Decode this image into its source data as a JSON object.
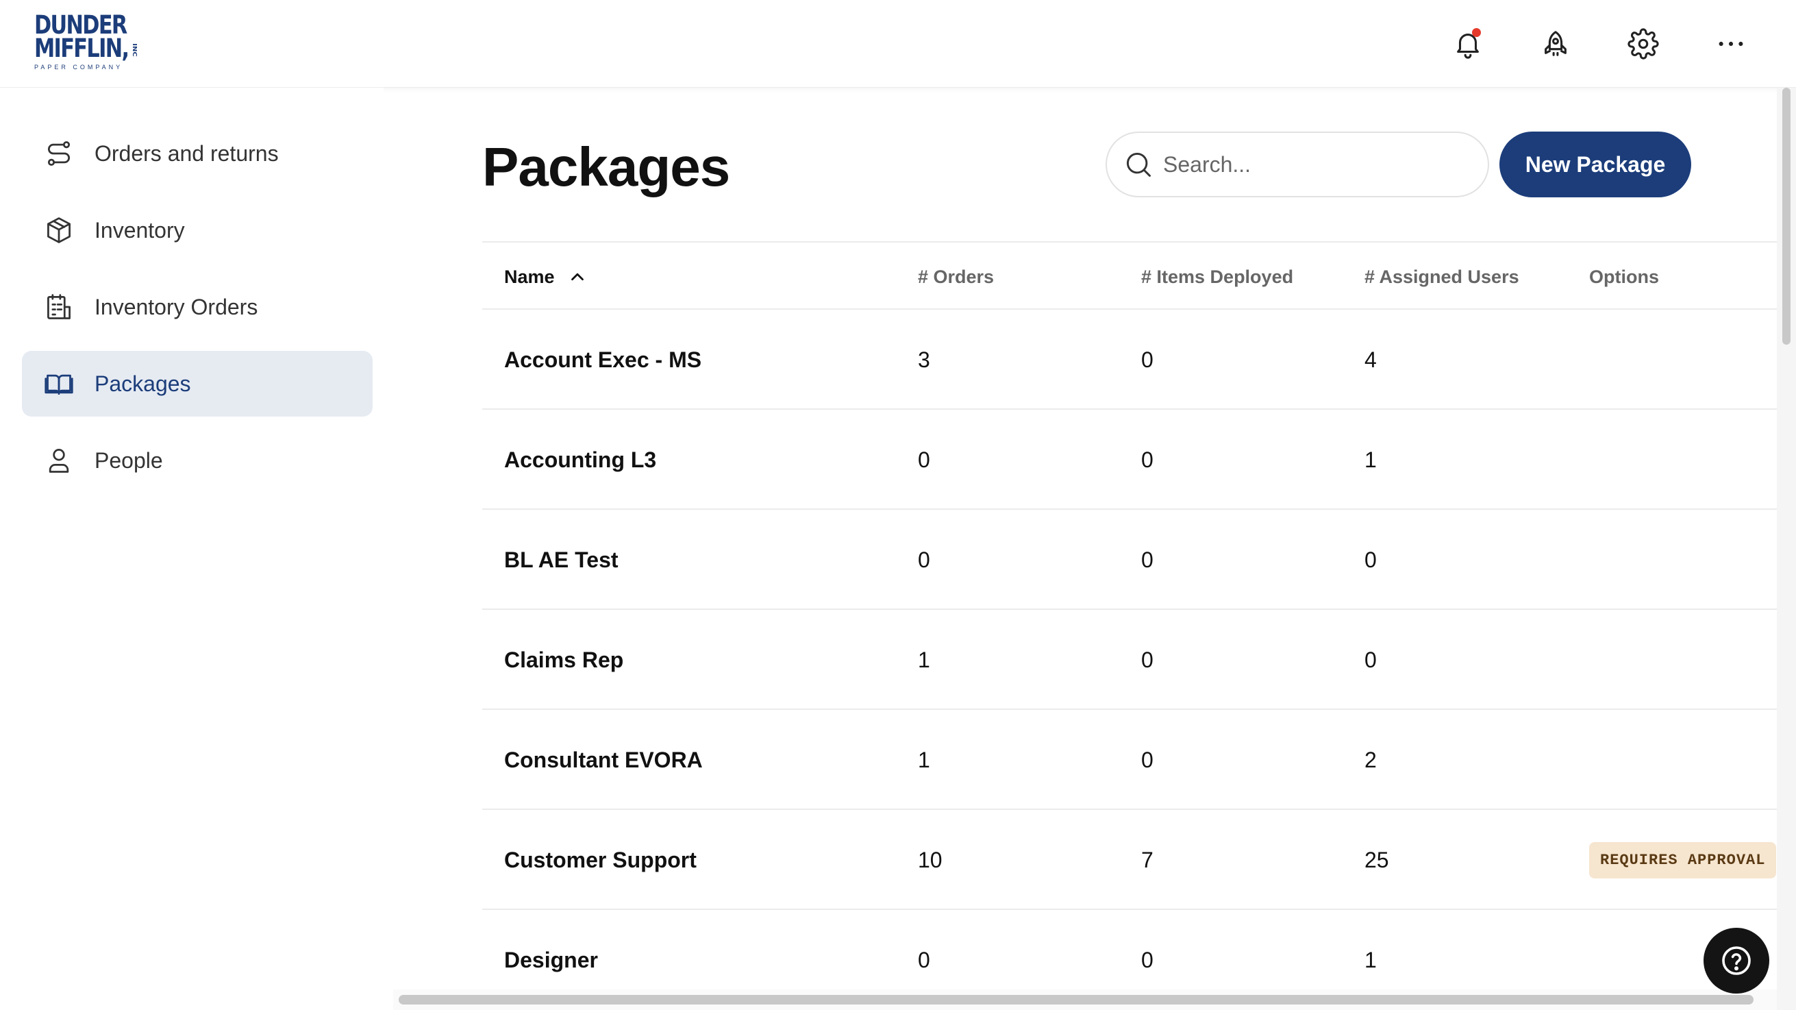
{
  "brand": {
    "logo_line1": "DUNDER",
    "logo_line2": "MIFFLIN,",
    "logo_line3": "PAPER COMPANY",
    "logo_inc": "INC",
    "brand_color": "#1c3d7a"
  },
  "header": {
    "icons": [
      "bell-icon",
      "rocket-icon",
      "gear-icon",
      "more-icon"
    ],
    "notification_dot_color": "#e5392b"
  },
  "sidebar": {
    "items": [
      {
        "label": "Orders and returns",
        "icon": "route-icon",
        "active": false
      },
      {
        "label": "Inventory",
        "icon": "box-icon",
        "active": false
      },
      {
        "label": "Inventory Orders",
        "icon": "clipboard-icon",
        "active": false
      },
      {
        "label": "Packages",
        "icon": "book-icon",
        "active": true
      },
      {
        "label": "People",
        "icon": "user-icon",
        "active": false
      }
    ]
  },
  "main": {
    "title": "Packages",
    "search": {
      "placeholder": "Search...",
      "value": ""
    },
    "new_button_label": "New Package",
    "table": {
      "columns": [
        {
          "label": "Name",
          "sorted": "ascending"
        },
        {
          "label": "# Orders"
        },
        {
          "label": "# Items Deployed"
        },
        {
          "label": "# Assigned Users"
        },
        {
          "label": "Options"
        }
      ],
      "rows": [
        {
          "name": "Account Exec - MS",
          "orders": "3",
          "items": "0",
          "users": "4",
          "option": ""
        },
        {
          "name": "Accounting L3",
          "orders": "0",
          "items": "0",
          "users": "1",
          "option": ""
        },
        {
          "name": "BL AE Test",
          "orders": "0",
          "items": "0",
          "users": "0",
          "option": ""
        },
        {
          "name": "Claims Rep",
          "orders": "1",
          "items": "0",
          "users": "0",
          "option": ""
        },
        {
          "name": "Consultant EVORA",
          "orders": "1",
          "items": "0",
          "users": "2",
          "option": ""
        },
        {
          "name": "Customer Support",
          "orders": "10",
          "items": "7",
          "users": "25",
          "option": "REQUIRES APPROVAL"
        },
        {
          "name": "Designer",
          "orders": "0",
          "items": "0",
          "users": "1",
          "option": ""
        }
      ]
    }
  },
  "help": {
    "icon": "help-icon"
  }
}
